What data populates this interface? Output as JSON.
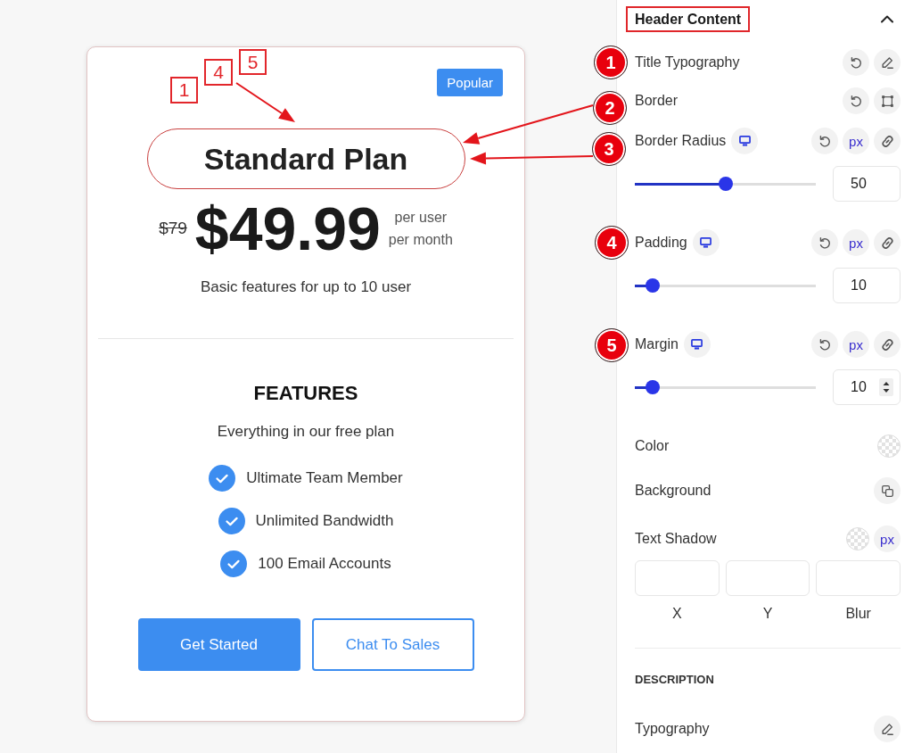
{
  "preview": {
    "badge": "Popular",
    "title": "Standard Plan",
    "old_price": "$79",
    "price": "$49.99",
    "period": [
      "per user",
      "per month"
    ],
    "description": "Basic features for up to 10 user",
    "features_title": "FEATURES",
    "features_subtitle": "Everything in our free plan",
    "features": [
      "Ultimate Team Member",
      "Unlimited Bandwidth",
      "100 Email Accounts"
    ],
    "buttons": [
      {
        "label": "Get Started",
        "kind": "primary"
      },
      {
        "label": "Chat To Sales",
        "kind": "outline"
      }
    ]
  },
  "panel": {
    "section": {
      "title": "Header Content",
      "highlighted": true,
      "expanded": true
    },
    "controls": [
      {
        "kind": "typography",
        "label": "Title Typography",
        "reset": true
      },
      {
        "kind": "border",
        "label": "Border",
        "reset": true
      },
      {
        "kind": "slider",
        "label": "Border Radius",
        "reset": true,
        "unit": "px",
        "level": 0.5,
        "value": "50",
        "stepper": false
      },
      {
        "kind": "slider",
        "label": "Padding",
        "reset": true,
        "unit": "px",
        "level": 0.1,
        "value": "10",
        "stepper": false
      },
      {
        "kind": "slider",
        "label": "Margin",
        "reset": true,
        "unit": "px",
        "level": 0.1,
        "value": "10",
        "stepper": true
      },
      {
        "kind": "color",
        "label": "Color"
      },
      {
        "kind": "background",
        "label": "Background"
      },
      {
        "kind": "text_shadow",
        "label": "Text Shadow",
        "unit": "px",
        "fields": [
          {
            "caption": "X"
          },
          {
            "caption": "Y"
          },
          {
            "caption": "Blur"
          }
        ]
      },
      {
        "kind": "heading",
        "label": "DESCRIPTION"
      },
      {
        "kind": "typography",
        "label": "Typography",
        "reset": false
      }
    ]
  },
  "annotations": {
    "markers": [
      "1",
      "2",
      "3",
      "4",
      "5"
    ],
    "callouts": [
      "1",
      "4",
      "5"
    ]
  }
}
